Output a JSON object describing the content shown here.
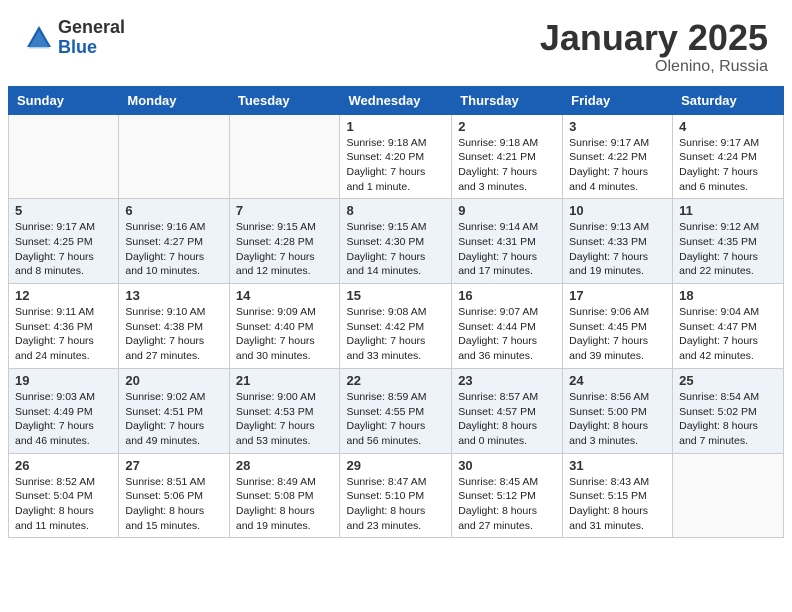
{
  "header": {
    "logo_general": "General",
    "logo_blue": "Blue",
    "month_title": "January 2025",
    "subtitle": "Olenino, Russia"
  },
  "weekdays": [
    "Sunday",
    "Monday",
    "Tuesday",
    "Wednesday",
    "Thursday",
    "Friday",
    "Saturday"
  ],
  "weeks": [
    [
      {
        "day": "",
        "info": ""
      },
      {
        "day": "",
        "info": ""
      },
      {
        "day": "",
        "info": ""
      },
      {
        "day": "1",
        "info": "Sunrise: 9:18 AM\nSunset: 4:20 PM\nDaylight: 7 hours\nand 1 minute."
      },
      {
        "day": "2",
        "info": "Sunrise: 9:18 AM\nSunset: 4:21 PM\nDaylight: 7 hours\nand 3 minutes."
      },
      {
        "day": "3",
        "info": "Sunrise: 9:17 AM\nSunset: 4:22 PM\nDaylight: 7 hours\nand 4 minutes."
      },
      {
        "day": "4",
        "info": "Sunrise: 9:17 AM\nSunset: 4:24 PM\nDaylight: 7 hours\nand 6 minutes."
      }
    ],
    [
      {
        "day": "5",
        "info": "Sunrise: 9:17 AM\nSunset: 4:25 PM\nDaylight: 7 hours\nand 8 minutes."
      },
      {
        "day": "6",
        "info": "Sunrise: 9:16 AM\nSunset: 4:27 PM\nDaylight: 7 hours\nand 10 minutes."
      },
      {
        "day": "7",
        "info": "Sunrise: 9:15 AM\nSunset: 4:28 PM\nDaylight: 7 hours\nand 12 minutes."
      },
      {
        "day": "8",
        "info": "Sunrise: 9:15 AM\nSunset: 4:30 PM\nDaylight: 7 hours\nand 14 minutes."
      },
      {
        "day": "9",
        "info": "Sunrise: 9:14 AM\nSunset: 4:31 PM\nDaylight: 7 hours\nand 17 minutes."
      },
      {
        "day": "10",
        "info": "Sunrise: 9:13 AM\nSunset: 4:33 PM\nDaylight: 7 hours\nand 19 minutes."
      },
      {
        "day": "11",
        "info": "Sunrise: 9:12 AM\nSunset: 4:35 PM\nDaylight: 7 hours\nand 22 minutes."
      }
    ],
    [
      {
        "day": "12",
        "info": "Sunrise: 9:11 AM\nSunset: 4:36 PM\nDaylight: 7 hours\nand 24 minutes."
      },
      {
        "day": "13",
        "info": "Sunrise: 9:10 AM\nSunset: 4:38 PM\nDaylight: 7 hours\nand 27 minutes."
      },
      {
        "day": "14",
        "info": "Sunrise: 9:09 AM\nSunset: 4:40 PM\nDaylight: 7 hours\nand 30 minutes."
      },
      {
        "day": "15",
        "info": "Sunrise: 9:08 AM\nSunset: 4:42 PM\nDaylight: 7 hours\nand 33 minutes."
      },
      {
        "day": "16",
        "info": "Sunrise: 9:07 AM\nSunset: 4:44 PM\nDaylight: 7 hours\nand 36 minutes."
      },
      {
        "day": "17",
        "info": "Sunrise: 9:06 AM\nSunset: 4:45 PM\nDaylight: 7 hours\nand 39 minutes."
      },
      {
        "day": "18",
        "info": "Sunrise: 9:04 AM\nSunset: 4:47 PM\nDaylight: 7 hours\nand 42 minutes."
      }
    ],
    [
      {
        "day": "19",
        "info": "Sunrise: 9:03 AM\nSunset: 4:49 PM\nDaylight: 7 hours\nand 46 minutes."
      },
      {
        "day": "20",
        "info": "Sunrise: 9:02 AM\nSunset: 4:51 PM\nDaylight: 7 hours\nand 49 minutes."
      },
      {
        "day": "21",
        "info": "Sunrise: 9:00 AM\nSunset: 4:53 PM\nDaylight: 7 hours\nand 53 minutes."
      },
      {
        "day": "22",
        "info": "Sunrise: 8:59 AM\nSunset: 4:55 PM\nDaylight: 7 hours\nand 56 minutes."
      },
      {
        "day": "23",
        "info": "Sunrise: 8:57 AM\nSunset: 4:57 PM\nDaylight: 8 hours\nand 0 minutes."
      },
      {
        "day": "24",
        "info": "Sunrise: 8:56 AM\nSunset: 5:00 PM\nDaylight: 8 hours\nand 3 minutes."
      },
      {
        "day": "25",
        "info": "Sunrise: 8:54 AM\nSunset: 5:02 PM\nDaylight: 8 hours\nand 7 minutes."
      }
    ],
    [
      {
        "day": "26",
        "info": "Sunrise: 8:52 AM\nSunset: 5:04 PM\nDaylight: 8 hours\nand 11 minutes."
      },
      {
        "day": "27",
        "info": "Sunrise: 8:51 AM\nSunset: 5:06 PM\nDaylight: 8 hours\nand 15 minutes."
      },
      {
        "day": "28",
        "info": "Sunrise: 8:49 AM\nSunset: 5:08 PM\nDaylight: 8 hours\nand 19 minutes."
      },
      {
        "day": "29",
        "info": "Sunrise: 8:47 AM\nSunset: 5:10 PM\nDaylight: 8 hours\nand 23 minutes."
      },
      {
        "day": "30",
        "info": "Sunrise: 8:45 AM\nSunset: 5:12 PM\nDaylight: 8 hours\nand 27 minutes."
      },
      {
        "day": "31",
        "info": "Sunrise: 8:43 AM\nSunset: 5:15 PM\nDaylight: 8 hours\nand 31 minutes."
      },
      {
        "day": "",
        "info": ""
      }
    ]
  ]
}
